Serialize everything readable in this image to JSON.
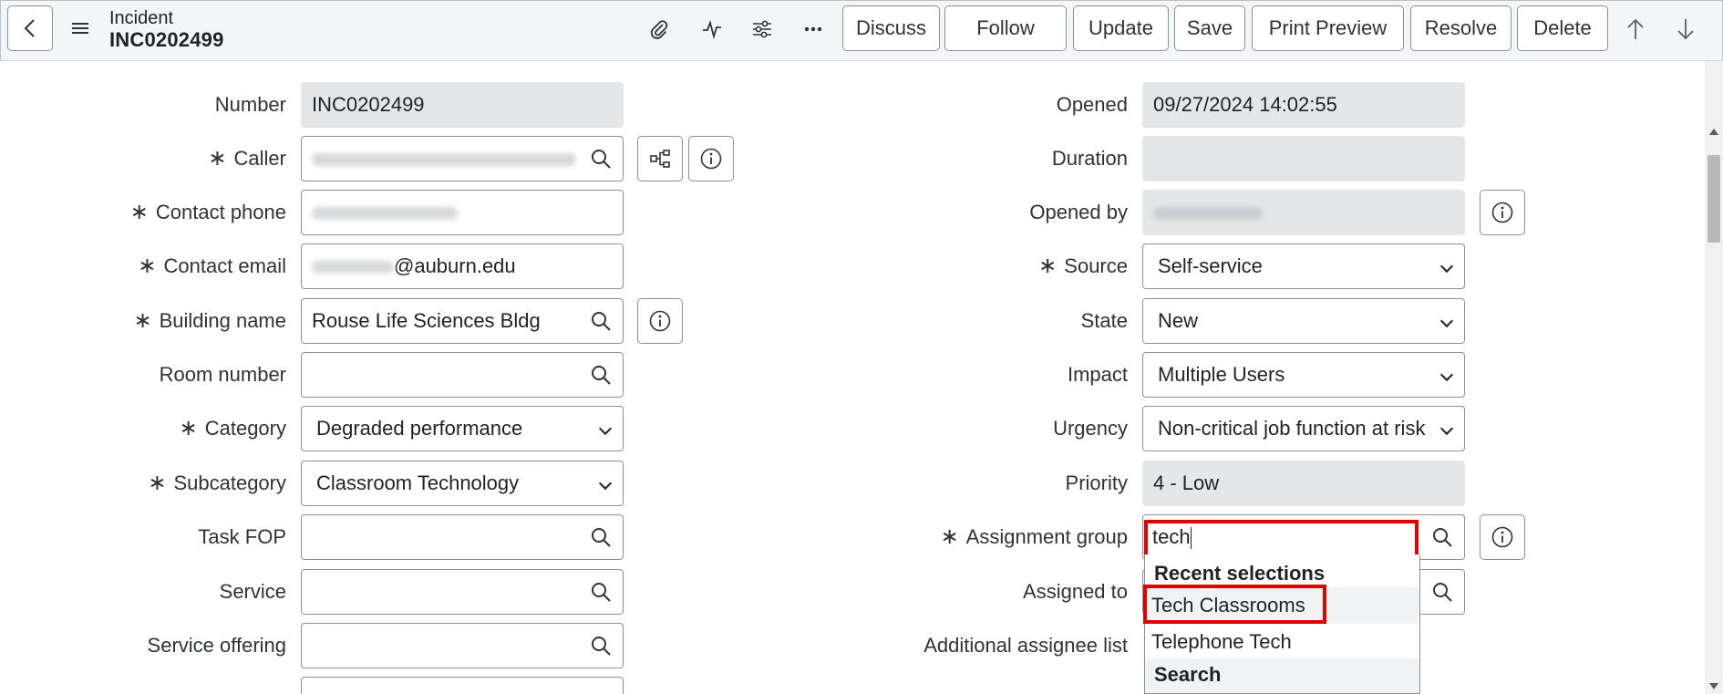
{
  "header": {
    "record_type": "Incident",
    "record_number": "INC0202499",
    "buttons": [
      "Discuss",
      "Follow",
      "Update",
      "Save",
      "Print Preview",
      "Resolve",
      "Delete"
    ]
  },
  "left_fields": [
    {
      "label": "Number",
      "required": false,
      "value": "INC0202499",
      "type": "readonly"
    },
    {
      "label": "Caller",
      "required": true,
      "value": "",
      "type": "lookup-blurred"
    },
    {
      "label": "Contact phone",
      "required": true,
      "value": "",
      "type": "text-blurred"
    },
    {
      "label": "Contact email",
      "required": true,
      "value": "@auburn.edu",
      "type": "text-partial-blurred"
    },
    {
      "label": "Building name",
      "required": true,
      "value": "Rouse Life Sciences Bldg",
      "type": "lookup"
    },
    {
      "label": "Room number",
      "required": false,
      "value": "",
      "type": "lookup"
    },
    {
      "label": "Category",
      "required": true,
      "value": "Degraded performance",
      "type": "select"
    },
    {
      "label": "Subcategory",
      "required": true,
      "value": "Classroom Technology",
      "type": "select"
    },
    {
      "label": "Task FOP",
      "required": false,
      "value": "",
      "type": "lookup"
    },
    {
      "label": "Service",
      "required": false,
      "value": "",
      "type": "lookup"
    },
    {
      "label": "Service offering",
      "required": false,
      "value": "",
      "type": "lookup"
    }
  ],
  "right_fields": [
    {
      "label": "Opened",
      "required": false,
      "value": "09/27/2024 14:02:55",
      "type": "readonly"
    },
    {
      "label": "Duration",
      "required": false,
      "value": "",
      "type": "readonly"
    },
    {
      "label": "Opened by",
      "required": false,
      "value": "",
      "type": "readonly-blurred"
    },
    {
      "label": "Source",
      "required": true,
      "value": "Self-service",
      "type": "select"
    },
    {
      "label": "State",
      "required": false,
      "value": "New",
      "type": "select"
    },
    {
      "label": "Impact",
      "required": false,
      "value": "Multiple Users",
      "type": "select"
    },
    {
      "label": "Urgency",
      "required": false,
      "value": "Non-critical job function at risk",
      "type": "select"
    },
    {
      "label": "Priority",
      "required": false,
      "value": "4 - Low",
      "type": "readonly"
    },
    {
      "label": "Assignment group",
      "required": true,
      "value": "tech",
      "type": "lookup-active"
    },
    {
      "label": "Assigned to",
      "required": false,
      "value": "",
      "type": "lookup"
    },
    {
      "label": "Additional assignee list",
      "required": false,
      "value": "",
      "type": "none"
    }
  ],
  "required_mark": "∗",
  "dropdown": {
    "recent_heading": "Recent selections",
    "items": [
      "Tech Classrooms",
      "Telephone Tech"
    ],
    "search_heading": "Search"
  },
  "colors": {
    "highlight_box": "#e00000",
    "readonly_bg": "#e4e6e8",
    "border": "#8a9096"
  }
}
